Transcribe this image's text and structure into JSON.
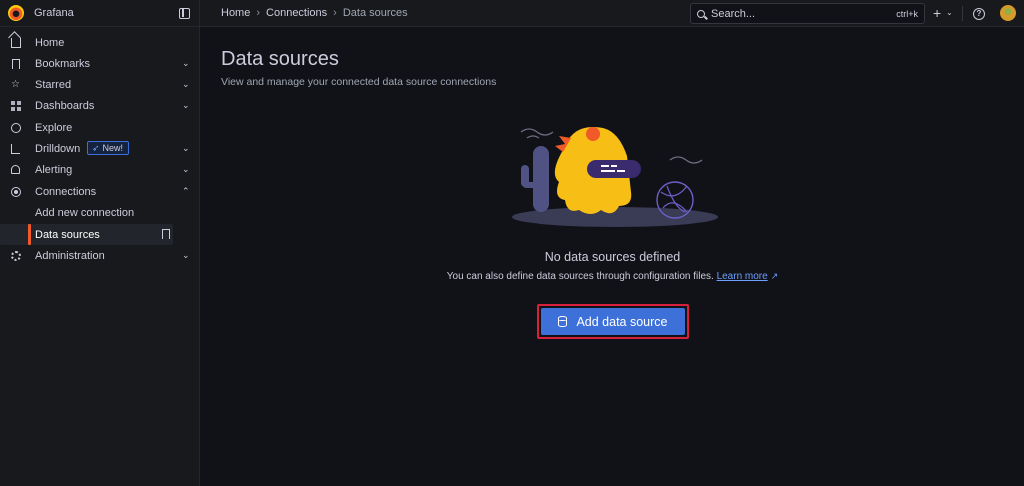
{
  "app": {
    "name": "Grafana"
  },
  "breadcrumbs": [
    "Home",
    "Connections",
    "Data sources"
  ],
  "search": {
    "placeholder": "Search...",
    "shortcut": "ctrl+k"
  },
  "sidebar": {
    "items": [
      {
        "label": "Home",
        "icon": "home-icon"
      },
      {
        "label": "Bookmarks",
        "icon": "bookmark-icon"
      },
      {
        "label": "Starred",
        "icon": "star-icon"
      },
      {
        "label": "Dashboards",
        "icon": "dashboards-icon"
      },
      {
        "label": "Explore",
        "icon": "compass-icon"
      },
      {
        "label": "Drilldown",
        "icon": "drilldown-icon",
        "badge": "New!"
      },
      {
        "label": "Alerting",
        "icon": "bell-icon"
      },
      {
        "label": "Connections",
        "icon": "connections-icon"
      },
      {
        "label": "Add new connection"
      },
      {
        "label": "Data sources"
      },
      {
        "label": "Administration",
        "icon": "gear-icon"
      }
    ]
  },
  "main": {
    "title": "Data sources",
    "subtitle": "View and manage your connected data source connections",
    "empty_title": "No data sources defined",
    "empty_text": "You can also define data sources through configuration files.",
    "learn_more": "Learn more",
    "add_button": "Add data source"
  },
  "colors": {
    "accent": "#3d71d9",
    "active_marker": "#f05a28",
    "highlight_border": "#d7213c"
  }
}
